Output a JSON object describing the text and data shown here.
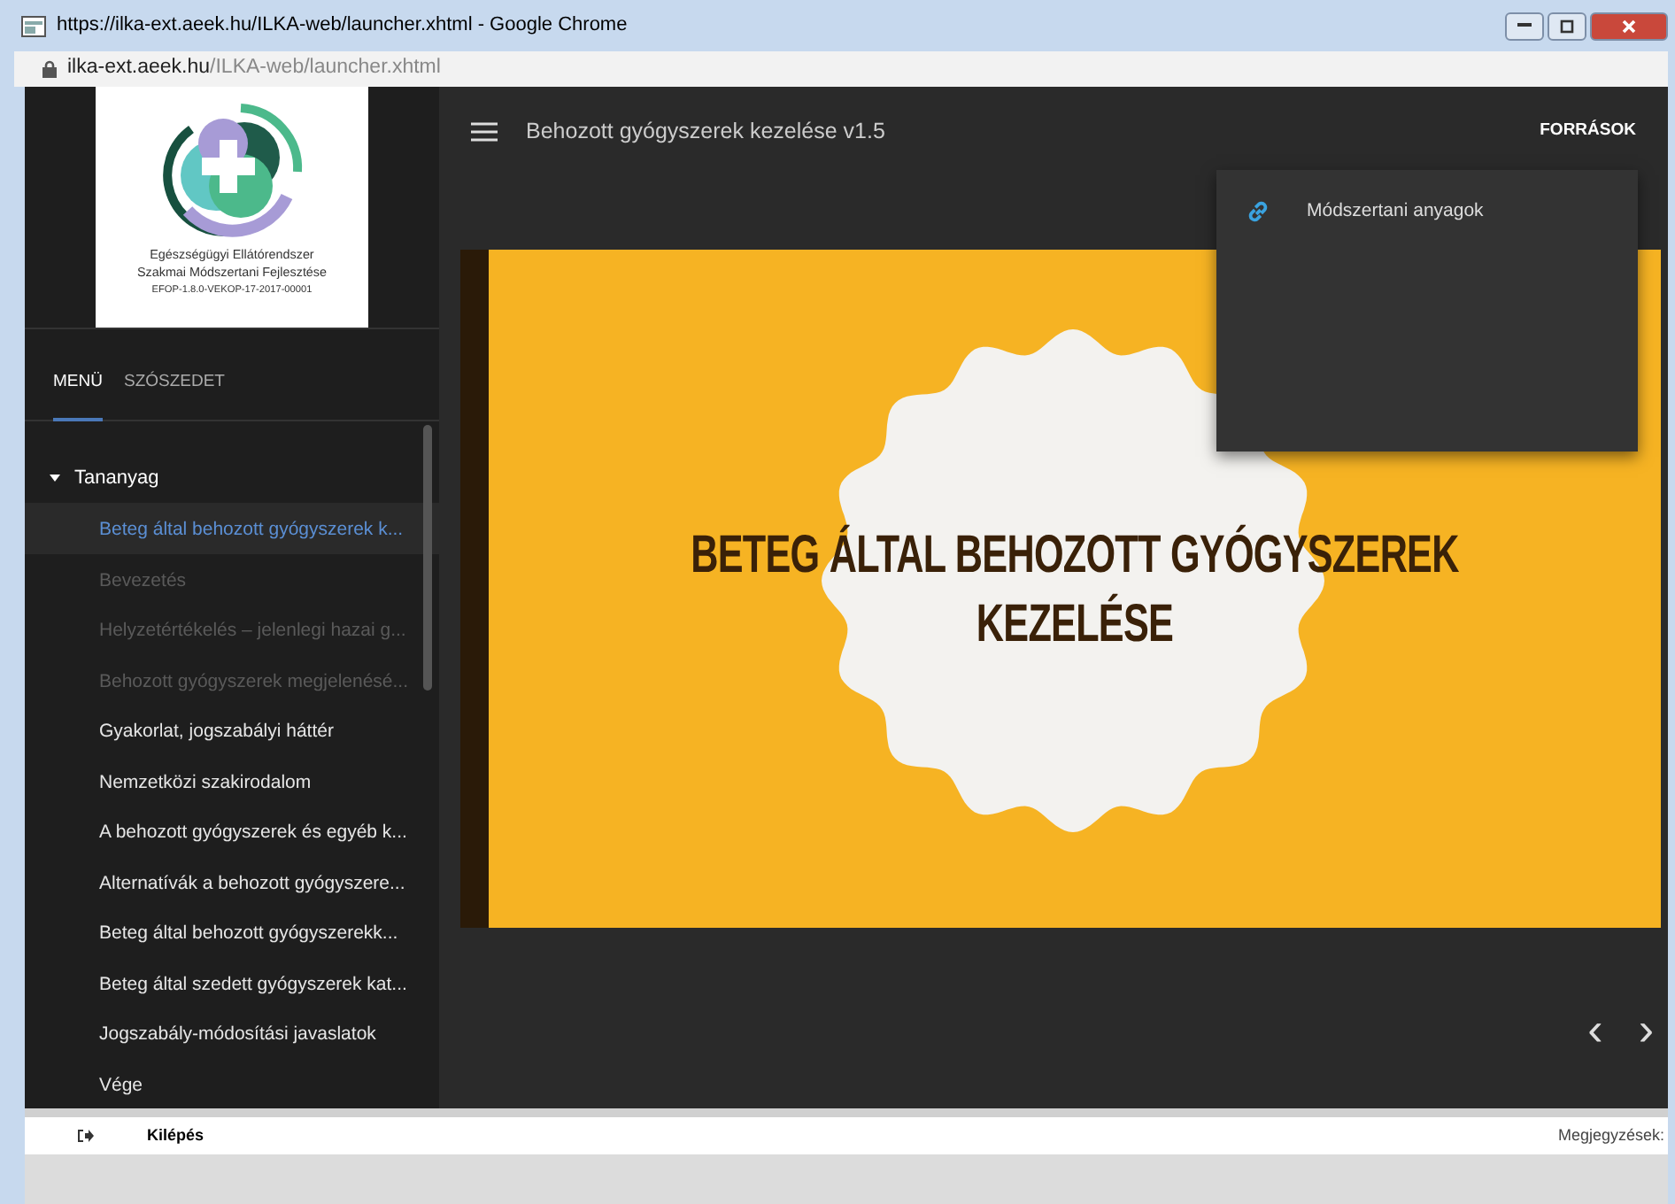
{
  "browser": {
    "title": "https://ilka-ext.aeek.hu/ILKA-web/launcher.xhtml - Google Chrome",
    "address_host": "ilka-ext.aeek.hu",
    "address_path": "/ILKA-web/launcher.xhtml"
  },
  "logo": {
    "line_1": "Egészségügyi Ellátórendszer",
    "line_2": "Szakmai Módszertani Fejlesztése",
    "line_3": "EFOP-1.8.0-VEKOP-17-2017-00001"
  },
  "tabs": [
    {
      "label": "MENÜ",
      "selected": true
    },
    {
      "label": "SZÓSZEDET",
      "selected": false
    }
  ],
  "menu": [
    {
      "label": "Tananyag",
      "expanded": true,
      "children": [
        {
          "label": "Beteg által behozott gyógyszerek k...",
          "selected": true,
          "disabled": false
        },
        {
          "label": "Bevezetés",
          "selected": false,
          "disabled": true
        },
        {
          "label": "Helyzetértékelés – jelenlegi hazai g...",
          "selected": false,
          "disabled": true
        },
        {
          "label": "Behozott gyógyszerek megjelenésé...",
          "selected": false,
          "disabled": true
        },
        {
          "label": "Gyakorlat, jogszabályi háttér",
          "selected": false,
          "disabled": false
        },
        {
          "label": "Nemzetközi szakirodalom",
          "selected": false,
          "disabled": false
        },
        {
          "label": "A behozott gyógyszerek és egyéb k...",
          "selected": false,
          "disabled": false
        },
        {
          "label": "Alternatívák a behozott gyógyszere...",
          "selected": false,
          "disabled": false
        },
        {
          "label": "Beteg által behozott gyógyszerekk...",
          "selected": false,
          "disabled": false
        },
        {
          "label": "Beteg által szedett gyógyszerek kat...",
          "selected": false,
          "disabled": false
        },
        {
          "label": "Jogszabály-módosítási javaslatok",
          "selected": false,
          "disabled": false
        },
        {
          "label": "Vége",
          "selected": false,
          "disabled": false
        }
      ]
    }
  ],
  "header": {
    "title": "Behozott gyógyszerek kezelése v1.5",
    "resources_button": "FORRÁSOK"
  },
  "resources_menu": {
    "expanded": true,
    "items": [
      "Módszertani anyagok"
    ]
  },
  "slide": {
    "title": "BETEG ÁLTAL BEHOZOTT GYÓGYSZEREK KEZELÉSE"
  },
  "nav": {
    "prev": "‹",
    "next": "›"
  },
  "footer": {
    "logout": "Kilépés",
    "notes_label": "Megjegyzések:"
  }
}
